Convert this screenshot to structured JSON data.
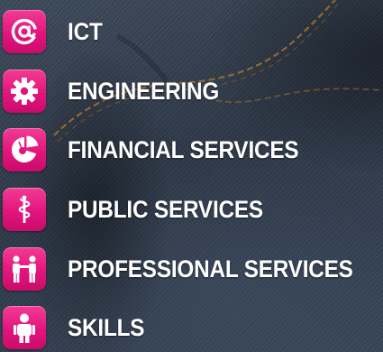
{
  "colors": {
    "icon_tile": "#e3157d",
    "label_text": "#ffffff",
    "background": "#2c3848",
    "stitching": "#b07a2e"
  },
  "items": [
    {
      "label": "ICT",
      "icon": "at-sign-icon"
    },
    {
      "label": "ENGINEERING",
      "icon": "gear-icon"
    },
    {
      "label": "FINANCIAL SERVICES",
      "icon": "pie-chart-icon"
    },
    {
      "label": "PUBLIC SERVICES",
      "icon": "caduceus-icon"
    },
    {
      "label": "PROFESSIONAL SERVICES",
      "icon": "handshake-people-icon"
    },
    {
      "label": "SKILLS",
      "icon": "person-icon"
    }
  ]
}
